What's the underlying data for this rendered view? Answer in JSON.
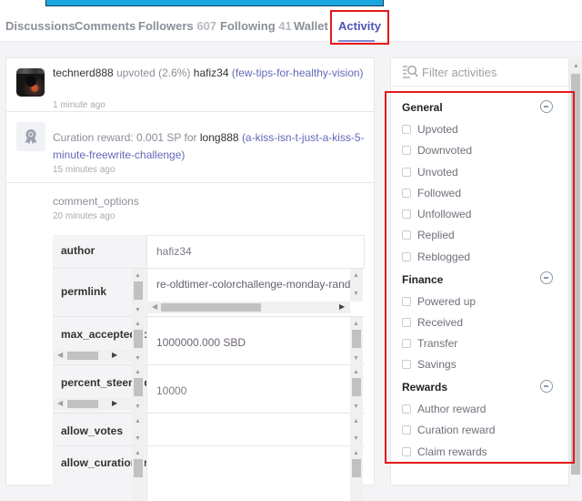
{
  "tabs": [
    {
      "label": "Discussions",
      "count": null,
      "active": false
    },
    {
      "label": "Comments",
      "count": null,
      "active": false
    },
    {
      "label": "Followers",
      "count": "607",
      "active": false
    },
    {
      "label": "Following",
      "count": "41",
      "active": false
    },
    {
      "label": "Wallet",
      "count": null,
      "active": false
    },
    {
      "label": "Activity",
      "count": null,
      "active": true
    }
  ],
  "feed": {
    "items": [
      {
        "icon": "avatar",
        "actor": "technerd888",
        "action": " upvoted (2.6%) ",
        "target": "hafiz34",
        "link": "(few-tips-for-healthy-vision)",
        "time": "1 minute ago"
      },
      {
        "icon": "award-icon",
        "prefix": "Curation reward: 0.001 SP for ",
        "target": "long888",
        "link": "(a-kiss-isn-t-just-a-kiss-5-minute-freewrite-challenge)",
        "time": "15 minutes ago"
      }
    ],
    "operation": {
      "name": "comment_options",
      "time": "20 minutes ago",
      "fields": [
        {
          "key": "author",
          "value": "hafiz34"
        },
        {
          "key": "permlink",
          "value": "re-oldtimer-colorchallenge-monday-rand"
        },
        {
          "key": "max_accepted_payout",
          "value": "1000000.000 SBD"
        },
        {
          "key": "percent_steem_dollars",
          "value": "10000"
        },
        {
          "key": "allow_votes",
          "value": ""
        },
        {
          "key": "allow_curation_rewards",
          "value": ""
        }
      ]
    }
  },
  "filters": {
    "search_placeholder": "Filter activities",
    "groups": [
      {
        "title": "General",
        "options": [
          "Upvoted",
          "Downvoted",
          "Unvoted",
          "Followed",
          "Unfollowed",
          "Replied",
          "Reblogged"
        ]
      },
      {
        "title": "Finance",
        "options": [
          "Powered up",
          "Received",
          "Transfer",
          "Savings"
        ]
      },
      {
        "title": "Rewards",
        "options": [
          "Author reward",
          "Curation reward",
          "Claim rewards"
        ]
      }
    ]
  },
  "colors": {
    "accent": "#4b55b5",
    "link": "#6468b8",
    "highlight": "#e41a1a"
  }
}
